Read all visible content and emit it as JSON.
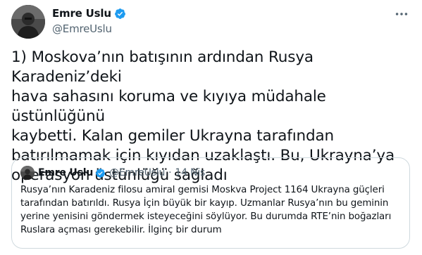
{
  "author": {
    "name": "Emre Uslu",
    "handle": "@EmreUslu"
  },
  "tweet": {
    "text": "1) Moskova’nın batışının ardından Rusya Karadeniz’deki\nhava sahasını koruma ve kıyıya müdahale üstünlüğünü\nkaybetti. Kalan gemiler Ukrayna tarafından\nbatırılmamak için kıyıdan uzaklaştı. Bu, Ukrayna’ya\noperasyon üstünlüğü sağladı"
  },
  "quoted_tweet": {
    "name": "Emre Uslu",
    "handle": "@EmreUslu",
    "separator": "·",
    "date": "14 Nis",
    "text": "Rusya’nın Karadeniz filosu amiral gemisi Moskva Project 1164 Ukrayna güçleri\ntarafından batırıldı. Rusya İçin büyük bir kayıp. Uzmanlar Rusya’nın bu geminin\nyerine yenisini göndermek isteyeceğini söylüyor. Bu durumda RTE’nin boğazları\nRuslara açması gerekebilir. İlginç bir durum"
  },
  "icons": {
    "verified": "verified-badge-icon",
    "more": "more-horizontal-icon"
  },
  "colors": {
    "text": "#0f1419",
    "secondary": "#536471",
    "verified": "#1d9bf0",
    "border": "#cfd9de"
  }
}
